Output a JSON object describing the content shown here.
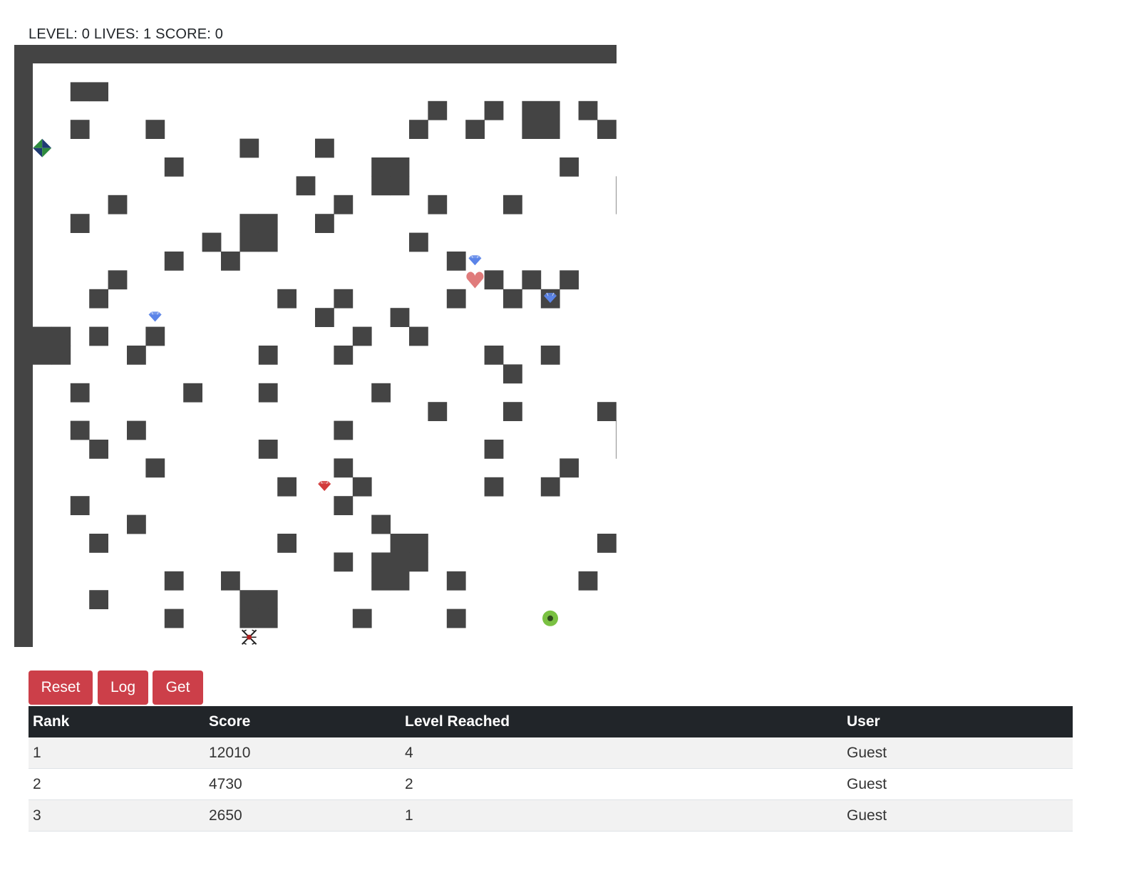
{
  "hud": {
    "text": "LEVEL: 0 LIVES: 1 SCORE: 0",
    "level": 0,
    "lives": 1,
    "score": 0
  },
  "colors": {
    "wall": "#444444",
    "floor": "#ffffff",
    "button_bg": "#cc3f49",
    "table_header_bg": "#212529",
    "gem_blue": "#5b84e8",
    "gem_red": "#d23a3a",
    "heart": "#e07b7b",
    "goal_green": "#7ac142",
    "player_green": "#2e8b3e",
    "player_navy": "#1f3b73"
  },
  "maze": {
    "grid_size": 32,
    "walls": [
      [
        2,
        1
      ],
      [
        3,
        1
      ],
      [
        21,
        2
      ],
      [
        24,
        2
      ],
      [
        26,
        2
      ],
      [
        27,
        2
      ],
      [
        29,
        2
      ],
      [
        2,
        3
      ],
      [
        6,
        3
      ],
      [
        20,
        3
      ],
      [
        23,
        3
      ],
      [
        26,
        3
      ],
      [
        27,
        3
      ],
      [
        30,
        3
      ],
      [
        11,
        4
      ],
      [
        15,
        4
      ],
      [
        7,
        5
      ],
      [
        18,
        5
      ],
      [
        19,
        5
      ],
      [
        28,
        5
      ],
      [
        14,
        6
      ],
      [
        18,
        6
      ],
      [
        19,
        6
      ],
      [
        31,
        6
      ],
      [
        4,
        7
      ],
      [
        16,
        7
      ],
      [
        21,
        7
      ],
      [
        25,
        7
      ],
      [
        31,
        7
      ],
      [
        2,
        8
      ],
      [
        11,
        8
      ],
      [
        12,
        8
      ],
      [
        15,
        8
      ],
      [
        9,
        9
      ],
      [
        11,
        9
      ],
      [
        12,
        9
      ],
      [
        20,
        9
      ],
      [
        7,
        10
      ],
      [
        10,
        10
      ],
      [
        22,
        10
      ],
      [
        4,
        11
      ],
      [
        24,
        11
      ],
      [
        26,
        11
      ],
      [
        28,
        11
      ],
      [
        3,
        12
      ],
      [
        13,
        12
      ],
      [
        16,
        12
      ],
      [
        22,
        12
      ],
      [
        25,
        12
      ],
      [
        27,
        12
      ],
      [
        15,
        13
      ],
      [
        19,
        13
      ],
      [
        0,
        14
      ],
      [
        1,
        14
      ],
      [
        3,
        14
      ],
      [
        6,
        14
      ],
      [
        17,
        14
      ],
      [
        20,
        14
      ],
      [
        0,
        15
      ],
      [
        1,
        15
      ],
      [
        5,
        15
      ],
      [
        12,
        15
      ],
      [
        16,
        15
      ],
      [
        24,
        15
      ],
      [
        27,
        15
      ],
      [
        25,
        16
      ],
      [
        2,
        17
      ],
      [
        8,
        17
      ],
      [
        12,
        17
      ],
      [
        18,
        17
      ],
      [
        21,
        18
      ],
      [
        25,
        18
      ],
      [
        30,
        18
      ],
      [
        2,
        19
      ],
      [
        5,
        19
      ],
      [
        16,
        19
      ],
      [
        31,
        19
      ],
      [
        3,
        20
      ],
      [
        12,
        20
      ],
      [
        24,
        20
      ],
      [
        31,
        20
      ],
      [
        6,
        21
      ],
      [
        16,
        21
      ],
      [
        28,
        21
      ],
      [
        13,
        22
      ],
      [
        17,
        22
      ],
      [
        24,
        22
      ],
      [
        27,
        22
      ],
      [
        2,
        23
      ],
      [
        16,
        23
      ],
      [
        5,
        24
      ],
      [
        18,
        24
      ],
      [
        3,
        25
      ],
      [
        13,
        25
      ],
      [
        19,
        25
      ],
      [
        20,
        25
      ],
      [
        30,
        25
      ],
      [
        16,
        26
      ],
      [
        18,
        26
      ],
      [
        19,
        26
      ],
      [
        20,
        26
      ],
      [
        7,
        27
      ],
      [
        10,
        27
      ],
      [
        18,
        27
      ],
      [
        19,
        27
      ],
      [
        22,
        27
      ],
      [
        29,
        27
      ],
      [
        3,
        28
      ],
      [
        11,
        28
      ],
      [
        12,
        28
      ],
      [
        7,
        29
      ],
      [
        11,
        29
      ],
      [
        12,
        29
      ],
      [
        17,
        29
      ],
      [
        22,
        29
      ]
    ],
    "items": [
      {
        "type": "player",
        "icon": "player-diamond-icon",
        "col": 0,
        "row": 4
      },
      {
        "type": "gem",
        "color": "blue",
        "icon": "blue-gem-icon",
        "col": 23,
        "row": 10
      },
      {
        "type": "heart",
        "icon": "heart-icon",
        "col": 23,
        "row": 11
      },
      {
        "type": "gem",
        "color": "blue",
        "icon": "blue-gem-icon",
        "col": 27,
        "row": 12
      },
      {
        "type": "gem",
        "color": "blue",
        "icon": "blue-gem-icon",
        "col": 6,
        "row": 13
      },
      {
        "type": "gem",
        "color": "red",
        "icon": "red-gem-icon",
        "col": 15,
        "row": 22
      },
      {
        "type": "goal",
        "icon": "goal-circle-icon",
        "col": 27,
        "row": 29
      },
      {
        "type": "spider",
        "icon": "spider-icon",
        "col": 11,
        "row": 30
      }
    ]
  },
  "buttons": {
    "reset": "Reset",
    "log": "Log",
    "get": "Get"
  },
  "leaderboard": {
    "headers": [
      "Rank",
      "Score",
      "Level Reached",
      "User"
    ],
    "rows": [
      [
        "1",
        "12010",
        "4",
        "Guest"
      ],
      [
        "2",
        "4730",
        "2",
        "Guest"
      ],
      [
        "3",
        "2650",
        "1",
        "Guest"
      ]
    ]
  }
}
